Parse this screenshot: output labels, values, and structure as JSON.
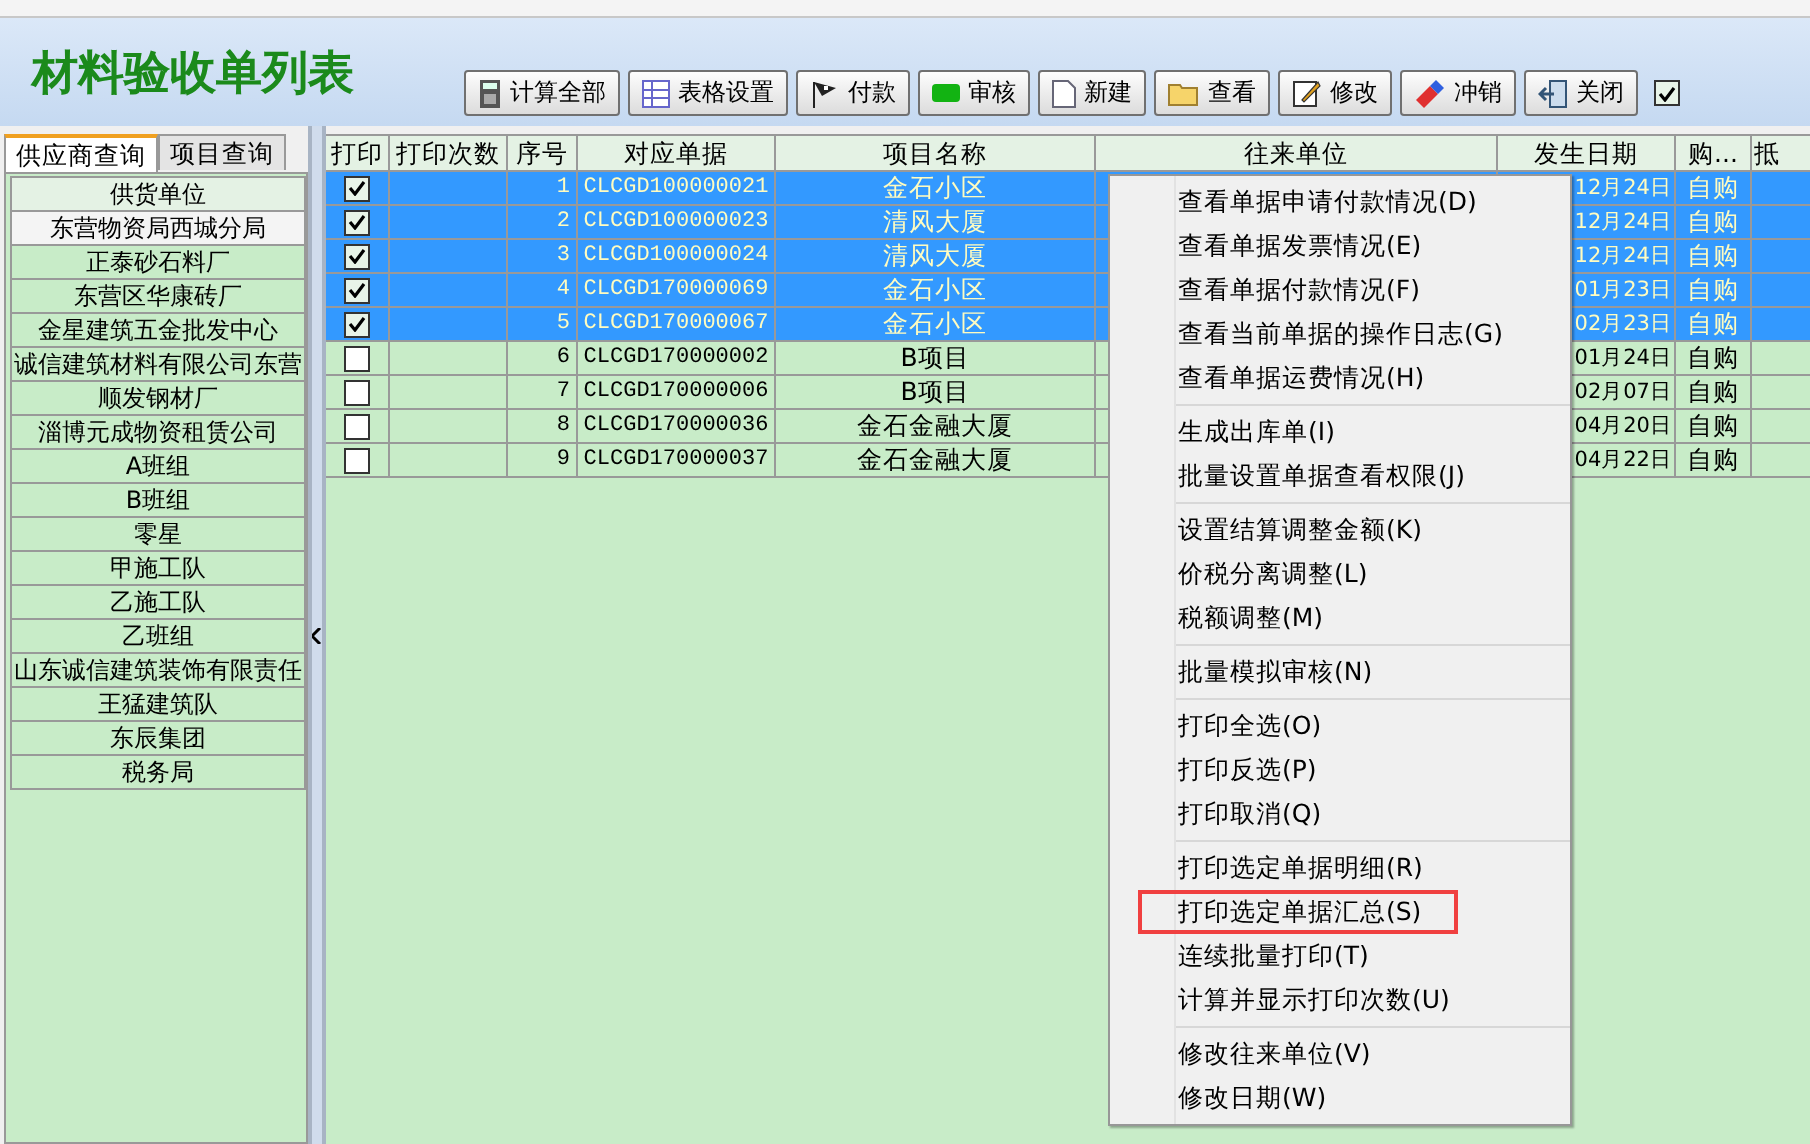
{
  "window": {
    "title": "材料验收单列表"
  },
  "toolbar": [
    {
      "label": "计算全部",
      "kind": "calculator"
    },
    {
      "label": "表格设置",
      "kind": "grid"
    },
    {
      "label": "付款",
      "kind": "flag"
    },
    {
      "label": "审核",
      "kind": "pill"
    },
    {
      "label": "新建",
      "kind": "page"
    },
    {
      "label": "查看",
      "kind": "folder"
    },
    {
      "label": "修改",
      "kind": "edit"
    },
    {
      "label": "冲销",
      "kind": "eraser"
    },
    {
      "label": "关闭",
      "kind": "exit"
    }
  ],
  "toolbar_checkbox": {
    "checked": true
  },
  "tabs": [
    {
      "label": "供应商查询",
      "selected": true
    },
    {
      "label": "项目查询",
      "selected": false
    }
  ],
  "supplier_list": {
    "header": "供货单位",
    "items": [
      {
        "label": "东营物资局西城分局",
        "selected": true
      },
      {
        "label": "正泰砂石料厂",
        "selected": false
      },
      {
        "label": "东营区华康砖厂",
        "selected": false
      },
      {
        "label": "金星建筑五金批发中心",
        "selected": false
      },
      {
        "label": "诚信建筑材料有限公司东营",
        "selected": false
      },
      {
        "label": "顺发钢材厂",
        "selected": false
      },
      {
        "label": "淄博元成物资租赁公司",
        "selected": false
      },
      {
        "label": "A班组",
        "selected": false
      },
      {
        "label": "B班组",
        "selected": false
      },
      {
        "label": "零星",
        "selected": false
      },
      {
        "label": "甲施工队",
        "selected": false
      },
      {
        "label": "乙施工队",
        "selected": false
      },
      {
        "label": "乙班组",
        "selected": false
      },
      {
        "label": "山东诚信建筑装饰有限责任",
        "selected": false
      },
      {
        "label": "王猛建筑队",
        "selected": false
      },
      {
        "label": "东辰集团",
        "selected": false
      },
      {
        "label": "税务局",
        "selected": false
      }
    ]
  },
  "table": {
    "columns": [
      "打印",
      "打印次数",
      "序号",
      "对应单据",
      "项目名称",
      "往来单位",
      "发生日期",
      "购...",
      "抵"
    ],
    "rows": [
      {
        "print": true,
        "selected": true,
        "no": "1",
        "doc": "CLCGD100000021",
        "project": "金石小区",
        "date": "12月24日",
        "type": "自购"
      },
      {
        "print": true,
        "selected": true,
        "no": "2",
        "doc": "CLCGD100000023",
        "project": "清风大厦",
        "date": "12月24日",
        "type": "自购"
      },
      {
        "print": true,
        "selected": true,
        "no": "3",
        "doc": "CLCGD100000024",
        "project": "清风大厦",
        "date": "12月24日",
        "type": "自购"
      },
      {
        "print": true,
        "selected": true,
        "no": "4",
        "doc": "CLCGD170000069",
        "project": "金石小区",
        "date": "01月23日",
        "type": "自购"
      },
      {
        "print": true,
        "selected": true,
        "no": "5",
        "doc": "CLCGD170000067",
        "project": "金石小区",
        "date": "02月23日",
        "type": "自购"
      },
      {
        "print": false,
        "selected": false,
        "no": "6",
        "doc": "CLCGD170000002",
        "project": "B项目",
        "date": "01月24日",
        "type": "自购"
      },
      {
        "print": false,
        "selected": false,
        "no": "7",
        "doc": "CLCGD170000006",
        "project": "B项目",
        "date": "02月07日",
        "type": "自购"
      },
      {
        "print": false,
        "selected": false,
        "no": "8",
        "doc": "CLCGD170000036",
        "project": "金石金融大厦",
        "date": "04月20日",
        "type": "自购"
      },
      {
        "print": false,
        "selected": false,
        "no": "9",
        "doc": "CLCGD170000037",
        "project": "金石金融大厦",
        "date": "04月22日",
        "type": "自购"
      }
    ]
  },
  "context_menu": {
    "groups": [
      [
        {
          "label": "查看单据申请付款情况(D)",
          "annotated": false
        },
        {
          "label": "查看单据发票情况(E)",
          "annotated": false
        },
        {
          "label": "查看单据付款情况(F)",
          "annotated": false
        },
        {
          "label": "查看当前单据的操作日志(G)",
          "annotated": false
        },
        {
          "label": "查看单据运费情况(H)",
          "annotated": false
        }
      ],
      [
        {
          "label": "生成出库单(I)",
          "annotated": false
        },
        {
          "label": "批量设置单据查看权限(J)",
          "annotated": false
        }
      ],
      [
        {
          "label": "设置结算调整金额(K)",
          "annotated": false
        },
        {
          "label": "价税分离调整(L)",
          "annotated": false
        },
        {
          "label": "税额调整(M)",
          "annotated": false
        }
      ],
      [
        {
          "label": "批量模拟审核(N)",
          "annotated": false
        }
      ],
      [
        {
          "label": "打印全选(O)",
          "annotated": false
        },
        {
          "label": "打印反选(P)",
          "annotated": false
        },
        {
          "label": "打印取消(Q)",
          "annotated": false
        }
      ],
      [
        {
          "label": "打印选定单据明细(R)",
          "annotated": false
        },
        {
          "label": "打印选定单据汇总(S)",
          "annotated": true
        },
        {
          "label": "连续批量打印(T)",
          "annotated": false
        },
        {
          "label": "计算并显示打印次数(U)",
          "annotated": false
        }
      ],
      [
        {
          "label": "修改往来单位(V)",
          "annotated": false
        },
        {
          "label": "修改日期(W)",
          "annotated": false
        }
      ]
    ]
  }
}
